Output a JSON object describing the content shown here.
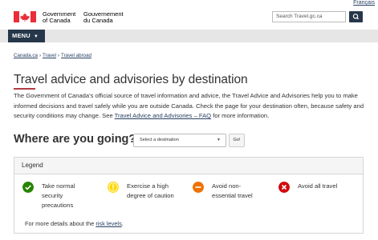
{
  "header": {
    "language_link": "Français",
    "wordmark_en_1": "Government",
    "wordmark_en_2": "of Canada",
    "wordmark_fr_1": "Gouvernement",
    "wordmark_fr_2": "du Canada",
    "search_placeholder": "Search Travel.gc.ca",
    "colors": {
      "flag_red": "#eb2d37",
      "navy": "#26374a",
      "link": "#284162",
      "accent": "#af3c43"
    }
  },
  "menu": {
    "label": "MENU"
  },
  "breadcrumb": [
    "Canada.ca",
    "Travel",
    "Travel abroad"
  ],
  "main": {
    "title": "Travel advice and advisories by destination",
    "intro_before_link": "The Government of Canada's official source of travel information and advice, the Travel Advice and Advisories help you to make informed decisions and travel safely while you are outside Canada. Check the page for your destination often, because safety and security conditions may change. See ",
    "intro_link": "Travel Advice and Advisories – FAQ",
    "intro_after_link": " for more information.",
    "where_heading": "Where are you going?",
    "destination_select": "Select a destination",
    "go_button": "Go!"
  },
  "legend": {
    "heading": "Legend",
    "items": [
      {
        "label_1": "Take normal",
        "label_2": "security",
        "label_3": "precautions",
        "color": "#278400",
        "icon": "check-circle-icon"
      },
      {
        "label_1": "Exercise a high",
        "label_2": "degree of caution",
        "color": "#ffd700",
        "icon": "exclamation-circle-icon"
      },
      {
        "label_1": "Avoid non-",
        "label_2": "essential travel",
        "color": "#ee7100",
        "icon": "minus-circle-icon"
      },
      {
        "label_1": "Avoid all travel",
        "color": "#d3080c",
        "icon": "x-circle-icon"
      }
    ],
    "more_before_link": "For more details about the ",
    "more_link": "risk levels",
    "more_after_link": "."
  }
}
